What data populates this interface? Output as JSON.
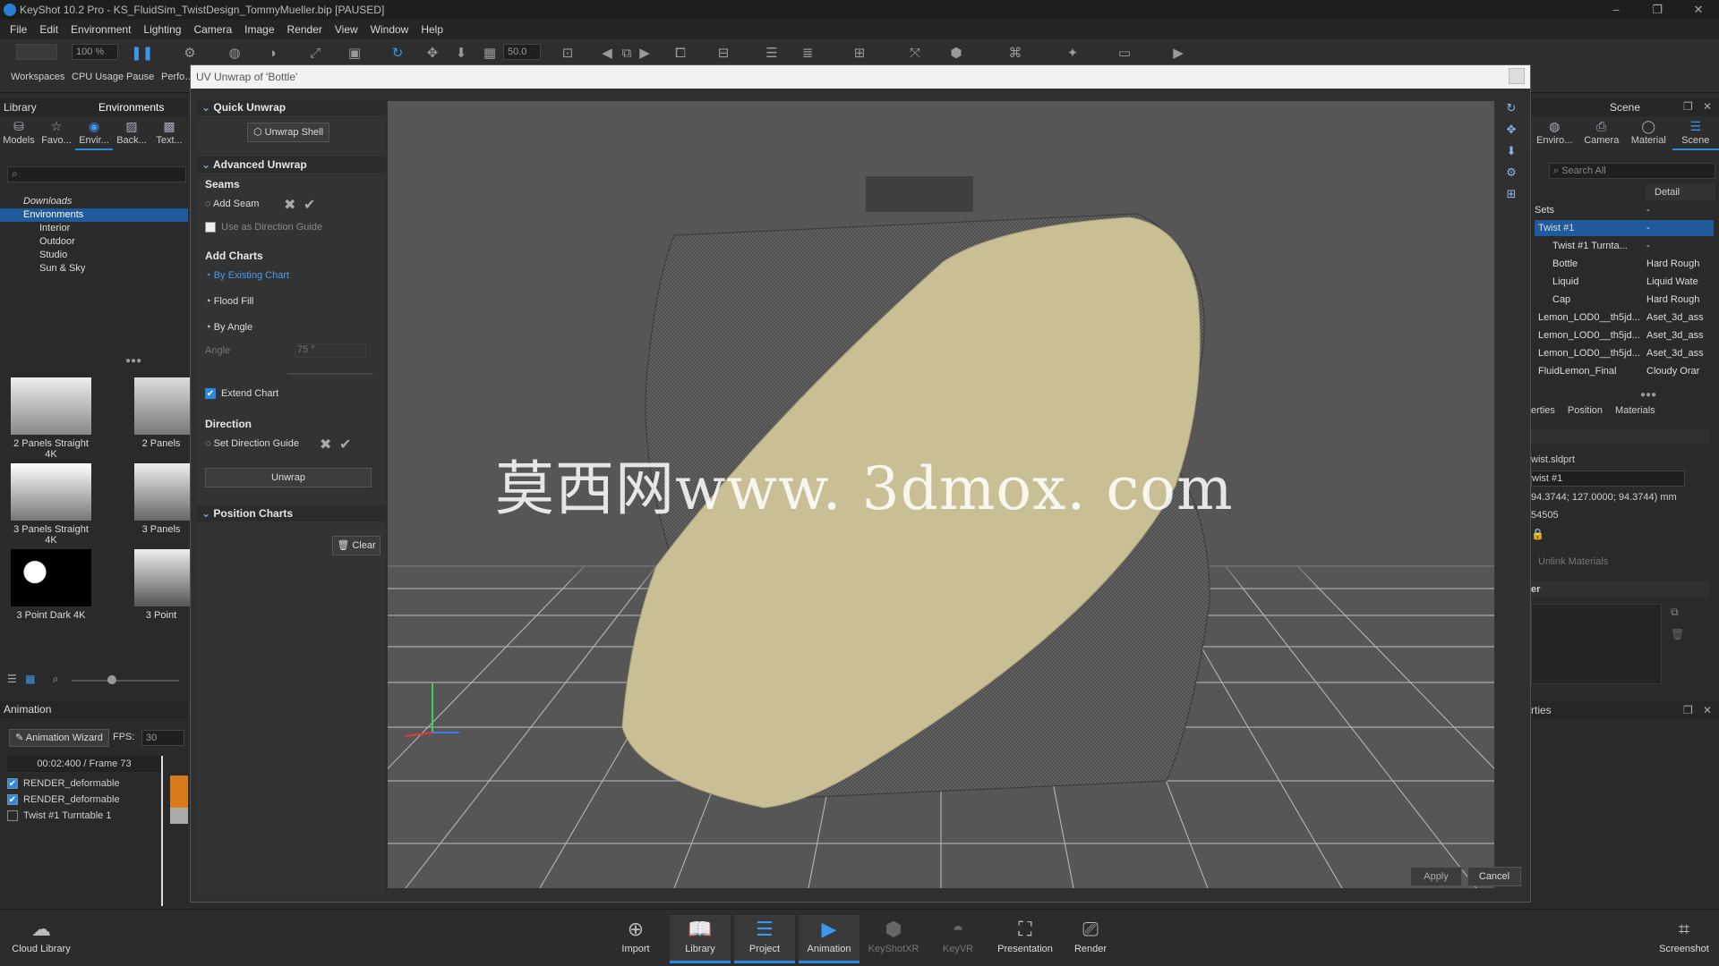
{
  "window": {
    "title": "KeyShot 10.2 Pro - KS_FluidSim_TwistDesign_TommyMueller.bip [PAUSED]"
  },
  "menu": [
    "File",
    "Edit",
    "Environment",
    "Lighting",
    "Camera",
    "Image",
    "Render",
    "View",
    "Window",
    "Help"
  ],
  "toolbar": {
    "zoom": "100 %",
    "fov": "50.0",
    "labels": [
      "Workspaces",
      "CPU Usage",
      "Pause",
      "Perfo…"
    ]
  },
  "library": {
    "header": "Library",
    "active_tab_title": "Environments",
    "tabs": [
      "Models",
      "Favo...",
      "Envir...",
      "Back...",
      "Text..."
    ],
    "tree": [
      "Downloads",
      "Environments",
      "Interior",
      "Outdoor",
      "Studio",
      "Sun & Sky"
    ],
    "thumbs": [
      "2 Panels Straight 4K",
      "2 Panels",
      "3 Panels Straight 4K",
      "3 Panels",
      "3 Point Dark 4K",
      "3 Point"
    ]
  },
  "animation": {
    "header": "Animation",
    "wizard": "Animation Wizard",
    "fps_label": "FPS:",
    "fps": "30",
    "time": "00:02:400 / Frame 73",
    "tracks": [
      {
        "name": "RENDER_deformable",
        "checked": true
      },
      {
        "name": "RENDER_deformable",
        "checked": true
      },
      {
        "name": "Twist #1 Turntable 1",
        "checked": false
      }
    ]
  },
  "dialog": {
    "title": "UV Unwrap of 'Bottle'",
    "quick_unwrap": "Quick Unwrap",
    "unwrap_shell": "Unwrap Shell",
    "advanced_unwrap": "Advanced Unwrap",
    "seams": "Seams",
    "add_seam": "Add Seam",
    "use_direction_guide": "Use as Direction Guide",
    "add_charts": "Add Charts",
    "by_existing_chart": "By Existing Chart",
    "flood_fill": "Flood Fill",
    "by_angle": "By Angle",
    "angle_label": "Angle",
    "angle_value": "75 °",
    "extend_chart": "Extend Chart",
    "direction": "Direction",
    "set_direction_guide": "Set Direction Guide",
    "unwrap": "Unwrap",
    "position_charts": "Position Charts",
    "clear": "Clear",
    "apply": "Apply",
    "cancel": "Cancel",
    "watermark": "莫西网www. 3dmox. com"
  },
  "scene": {
    "header": "Scene",
    "tabs": [
      "Enviro...",
      "Camera",
      "Material",
      "Scene"
    ],
    "search_placeholder": "Search All",
    "detail_col": "Detail",
    "rows": [
      {
        "name": "Sets",
        "detail": "-"
      },
      {
        "name": "Twist #1",
        "detail": "-"
      },
      {
        "name": "Twist #1 Turnta...",
        "detail": "-"
      },
      {
        "name": "Bottle",
        "detail": "Hard Rough"
      },
      {
        "name": "Liquid",
        "detail": "Liquid Wate"
      },
      {
        "name": "Cap",
        "detail": "Hard Rough"
      },
      {
        "name": "Lemon_LOD0__th5jd...",
        "detail": "Aset_3d_ass"
      },
      {
        "name": "Lemon_LOD0__th5jd...",
        "detail": "Aset_3d_ass"
      },
      {
        "name": "Lemon_LOD0__th5jd...",
        "detail": "Aset_3d_ass"
      },
      {
        "name": "FluidLemon_Final",
        "detail": "Cloudy Orar"
      }
    ],
    "props_tabs": [
      "erties",
      "Position",
      "Materials"
    ],
    "file": "wist.sldprt",
    "name_field": "wist #1",
    "dims": "94.3744; 127.0000; 94.3744) mm",
    "count": "54505",
    "unlink": "Unlink Materials",
    "layer_header": "er",
    "props_header": "rties"
  },
  "bottom": {
    "cloud": "Cloud Library",
    "buttons": [
      "Import",
      "Library",
      "Project",
      "Animation",
      "KeyShotXR",
      "KeyVR",
      "Presentation",
      "Render"
    ],
    "screenshot": "Screenshot"
  }
}
